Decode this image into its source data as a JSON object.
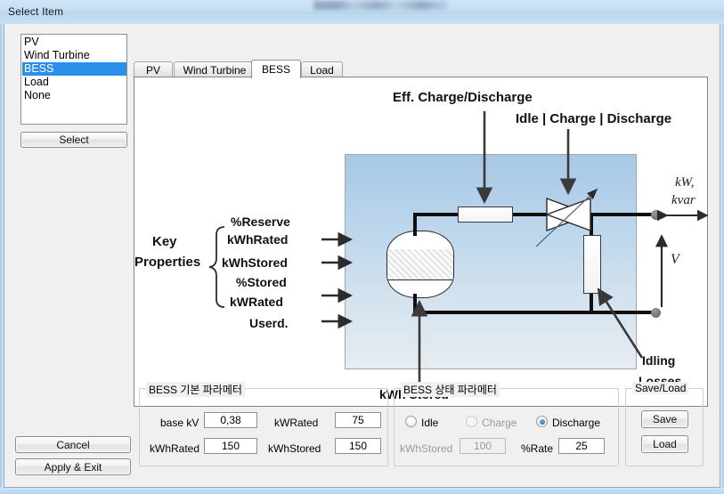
{
  "window": {
    "title": "Select Item",
    "redacted_titlebar_text": ""
  },
  "sidebar": {
    "list": {
      "items": [
        {
          "label": "PV",
          "selected": false
        },
        {
          "label": "Wind Turbine",
          "selected": false
        },
        {
          "label": "BESS",
          "selected": true
        },
        {
          "label": "Load",
          "selected": false
        },
        {
          "label": "None",
          "selected": false
        }
      ]
    },
    "select_button": "Select",
    "cancel_button": "Cancel",
    "apply_exit_button": "Apply & Exit"
  },
  "tabs": [
    {
      "label": "PV",
      "active": false
    },
    {
      "label": "Wind Turbine",
      "active": false
    },
    {
      "label": "BESS",
      "active": true
    },
    {
      "label": "Load",
      "active": false
    }
  ],
  "diagram": {
    "title_eff": "Eff. Charge/Discharge",
    "title_modes": "Idle | Charge | Discharge",
    "key_properties_line1": "Key",
    "key_properties_line2": "Properties",
    "properties": [
      "%Reserve",
      "kWhRated",
      "kWhStored",
      "%Stored",
      "kWRated",
      "Userd."
    ],
    "label_kwh_stored": "kWh Stored",
    "label_idling_line1": "Idling",
    "label_idling_line2": "Losses",
    "label_kw": "kW,",
    "label_kvar": "kvar",
    "label_v": "V"
  },
  "basic_params": {
    "group_title": "BESS 기본 파라메터",
    "fields": [
      {
        "label": "base kV",
        "value": "0,38",
        "disabled": false
      },
      {
        "label": "kWRated",
        "value": "75",
        "disabled": false
      },
      {
        "label": "kWhRated",
        "value": "150",
        "disabled": false
      },
      {
        "label": "kWhStored",
        "value": "150",
        "disabled": false
      }
    ]
  },
  "state_params": {
    "group_title": "BESS 상태 파라메터",
    "radios": [
      {
        "label": "Idle",
        "checked": false,
        "disabled": false
      },
      {
        "label": "Charge",
        "checked": false,
        "disabled": true
      },
      {
        "label": "Discharge",
        "checked": true,
        "disabled": false
      }
    ],
    "fields": [
      {
        "label": "kWhStored",
        "value": "100",
        "disabled": true
      },
      {
        "label": "%Rate",
        "value": "25",
        "disabled": false
      }
    ]
  },
  "save_load": {
    "group_title": "Save/Load",
    "save_button": "Save",
    "load_button": "Load"
  },
  "colors": {
    "selection_blue": "#2a8fe8",
    "titlebar_blue": "#c5ddf4",
    "diagram_panel_blue": "#b8d2e9",
    "window_face": "#f0f0f0"
  }
}
